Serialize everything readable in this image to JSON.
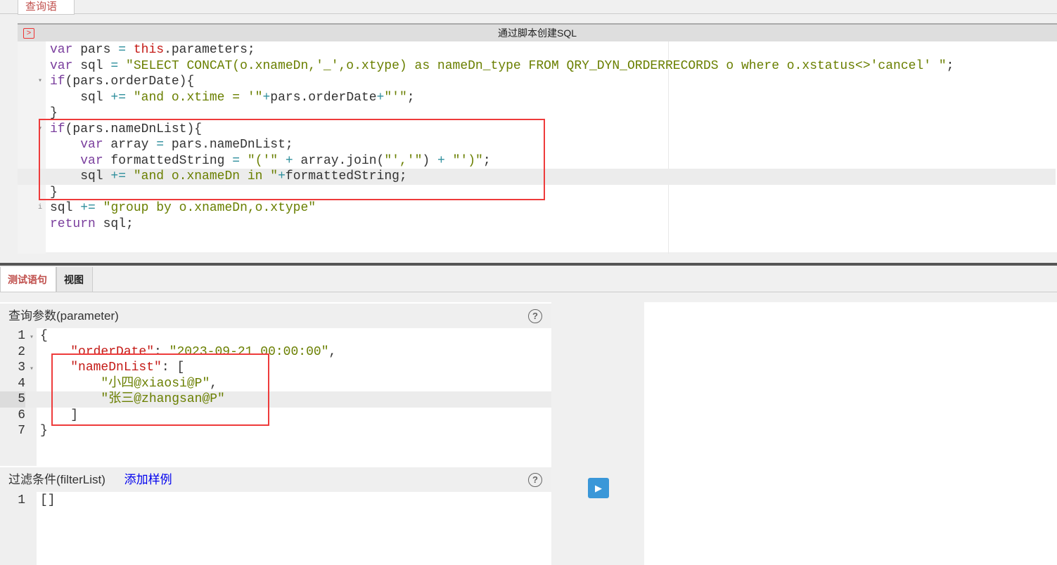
{
  "top_tab": "查询语句",
  "editor": {
    "title": "通过脚本创建SQL",
    "active_line": 9,
    "fold_lines": [
      3,
      6
    ],
    "info_line": 11,
    "lines": [
      [
        [
          "k",
          "var"
        ],
        [
          "p",
          " pars "
        ],
        [
          "o",
          "="
        ],
        [
          "p",
          " "
        ],
        [
          "r",
          "this"
        ],
        [
          "p",
          ".parameters;"
        ]
      ],
      [
        [
          "k",
          "var"
        ],
        [
          "p",
          " sql "
        ],
        [
          "o",
          "="
        ],
        [
          "p",
          " "
        ],
        [
          "s",
          "\"SELECT CONCAT(o.xnameDn,'_',o.xtype) as nameDn_type FROM QRY_DYN_ORDERRECORDS o where o.xstatus<>'cancel' \""
        ],
        [
          "p",
          ";"
        ]
      ],
      [
        [
          "k",
          "if"
        ],
        [
          "p",
          "(pars.orderDate){"
        ]
      ],
      [
        [
          "p",
          "    sql "
        ],
        [
          "o",
          "+="
        ],
        [
          "p",
          " "
        ],
        [
          "s",
          "\"and o.xtime = '\""
        ],
        [
          "o",
          "+"
        ],
        [
          "p",
          "pars.orderDate"
        ],
        [
          "o",
          "+"
        ],
        [
          "s",
          "\"'\""
        ],
        [
          "p",
          ";"
        ]
      ],
      [
        [
          "p",
          "}"
        ]
      ],
      [
        [
          "k",
          "if"
        ],
        [
          "p",
          "(pars.nameDnList){"
        ]
      ],
      [
        [
          "p",
          "    "
        ],
        [
          "k",
          "var"
        ],
        [
          "p",
          " array "
        ],
        [
          "o",
          "="
        ],
        [
          "p",
          " pars.nameDnList;"
        ]
      ],
      [
        [
          "p",
          "    "
        ],
        [
          "k",
          "var"
        ],
        [
          "p",
          " formattedString "
        ],
        [
          "o",
          "="
        ],
        [
          "p",
          " "
        ],
        [
          "s",
          "\"('\""
        ],
        [
          "p",
          " "
        ],
        [
          "o",
          "+"
        ],
        [
          "p",
          " array.join("
        ],
        [
          "s",
          "\"','\""
        ],
        [
          "p",
          ") "
        ],
        [
          "o",
          "+"
        ],
        [
          "p",
          " "
        ],
        [
          "s",
          "\"')\""
        ],
        [
          "p",
          ";"
        ]
      ],
      [
        [
          "p",
          "    sql "
        ],
        [
          "o",
          "+="
        ],
        [
          "p",
          " "
        ],
        [
          "s",
          "\"and o.xnameDn in \""
        ],
        [
          "o",
          "+"
        ],
        [
          "p",
          "formattedString;"
        ]
      ],
      [
        [
          "p",
          "}"
        ]
      ],
      [
        [
          "p",
          "sql "
        ],
        [
          "o",
          "+="
        ],
        [
          "p",
          " "
        ],
        [
          "s",
          "\"group by o.xnameDn,o.xtype\""
        ]
      ],
      [
        [
          "k",
          "return"
        ],
        [
          "p",
          " sql;"
        ]
      ]
    ]
  },
  "bottom_tabs": [
    {
      "label": "测试语句",
      "active": true
    },
    {
      "label": "视图",
      "active": false
    }
  ],
  "parameter": {
    "title": "查询参数(parameter)",
    "help": "?",
    "active_line": 5,
    "fold_lines": [
      1,
      3
    ],
    "lines": [
      [
        [
          "p",
          "{"
        ]
      ],
      [
        [
          "p",
          "    "
        ],
        [
          "j",
          "\"orderDate\""
        ],
        [
          "p",
          ": "
        ],
        [
          "s",
          "\"2023-09-21 00:00:00\""
        ],
        [
          "p",
          ","
        ]
      ],
      [
        [
          "p",
          "    "
        ],
        [
          "j",
          "\"nameDnList\""
        ],
        [
          "p",
          ": ["
        ]
      ],
      [
        [
          "p",
          "        "
        ],
        [
          "s",
          "\"小四@xiaosi@P\""
        ],
        [
          "p",
          ","
        ]
      ],
      [
        [
          "p",
          "        "
        ],
        [
          "s",
          "\"张三@zhangsan@P\""
        ]
      ],
      [
        [
          "p",
          "    ]"
        ]
      ],
      [
        [
          "p",
          "}"
        ]
      ]
    ]
  },
  "filter": {
    "title": "过滤条件(filterList)",
    "add_sample": "添加样例",
    "help": "?",
    "lines": [
      [
        [
          "p",
          "[]"
        ]
      ]
    ]
  },
  "run_button": "▶"
}
